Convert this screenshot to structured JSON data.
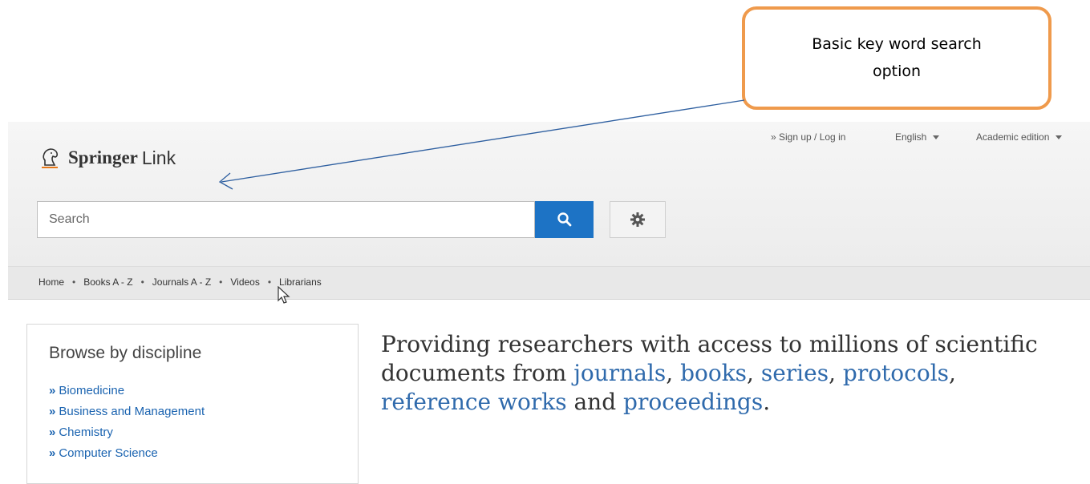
{
  "callout": {
    "line1": "Basic key word search",
    "line2": "option"
  },
  "header": {
    "brand": "Springer",
    "brand_suffix": "Link",
    "signup": "» Sign up / Log in",
    "language": "English",
    "edition": "Academic edition"
  },
  "search": {
    "placeholder": "Search"
  },
  "nav": {
    "items": [
      "Home",
      "Books A - Z",
      "Journals A - Z",
      "Videos",
      "Librarians"
    ],
    "separator": "•"
  },
  "browse": {
    "title": "Browse by discipline",
    "items": [
      "Biomedicine",
      "Business and Management",
      "Chemistry",
      "Computer Science"
    ],
    "bullet": "»"
  },
  "tagline": {
    "intro": "Providing researchers with access to millions of scientific documents from ",
    "link1": "journals",
    "sep1": ", ",
    "link2": "books",
    "sep2": ", ",
    "link3": "series",
    "sep3": ", ",
    "link4": "protocols",
    "sep4": ", ",
    "link5": "reference works",
    "sep5": " and ",
    "link6": "proceedings",
    "end": "."
  },
  "colors": {
    "accent": "#1d73c5",
    "callout_border": "#ef9a4c",
    "link": "#1a63b0"
  }
}
